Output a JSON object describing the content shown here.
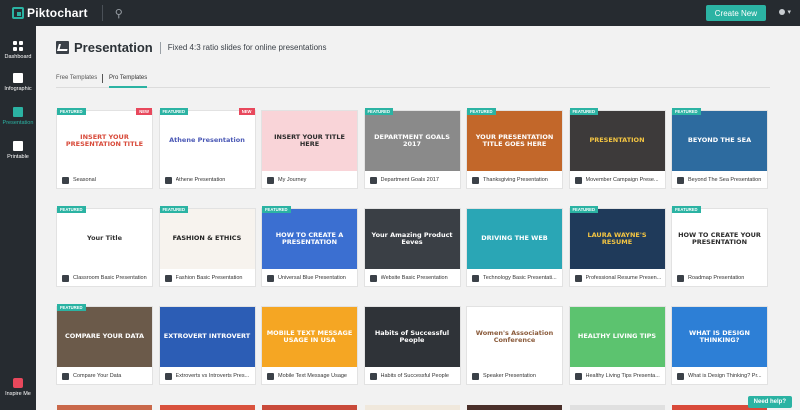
{
  "app": {
    "logo": "Piktochart"
  },
  "topbar": {
    "create_label": "Create New"
  },
  "sidebar": {
    "items": [
      {
        "label": "Dashboard",
        "icon": "dashboard-icon"
      },
      {
        "label": "Infographic",
        "icon": "infographic-icon"
      },
      {
        "label": "Presentation",
        "icon": "presentation-icon"
      },
      {
        "label": "Printable",
        "icon": "printable-icon"
      }
    ],
    "inspire_label": "Inspire Me"
  },
  "header": {
    "title": "Presentation",
    "subtitle": "Fixed 4:3 ratio slides for online presentations"
  },
  "tabs": [
    {
      "label": "Free Templates"
    },
    {
      "label": "Pro Templates"
    }
  ],
  "badges": {
    "featured": "FEATURED",
    "new": "NEW"
  },
  "templates": [
    {
      "name": "Seasonal",
      "thumb": "INSERT YOUR PRESENTATION TITLE",
      "bg": "#ffffff",
      "fg": "#d84a3a",
      "featured": true,
      "new": true
    },
    {
      "name": "Athene Presentation",
      "thumb": "Athene Presentation",
      "bg": "#ffffff",
      "fg": "#4a58b5",
      "featured": true,
      "new": true
    },
    {
      "name": "My Journey",
      "thumb": "INSERT YOUR TITLE HERE",
      "bg": "#f9d4d8",
      "fg": "#2a2a2a",
      "featured": false,
      "new": false
    },
    {
      "name": "Department Goals 2017",
      "thumb": "DEPARTMENT GOALS 2017",
      "bg": "#8a8a8a",
      "fg": "#ffffff",
      "featured": true,
      "new": false
    },
    {
      "name": "Thanksgiving Presentation",
      "thumb": "YOUR PRESENTATION TITLE GOES HERE",
      "bg": "#c2672a",
      "fg": "#ffffff",
      "featured": true,
      "new": false
    },
    {
      "name": "Movember Campaign Prese...",
      "thumb": "PRESENTATION",
      "bg": "#3d3a3a",
      "fg": "#f4c542",
      "featured": true,
      "new": false
    },
    {
      "name": "Beyond The Sea Presentation",
      "thumb": "BEYOND THE SEA",
      "bg": "#2d6b9f",
      "fg": "#ffffff",
      "featured": true,
      "new": false
    },
    {
      "name": "Classroom Basic Presentation",
      "thumb": "Your Title",
      "bg": "#ffffff",
      "fg": "#333333",
      "featured": true,
      "new": false
    },
    {
      "name": "Fashion Basic Presentation",
      "thumb": "FASHION & ETHICS",
      "bg": "#f7f3ee",
      "fg": "#222222",
      "featured": true,
      "new": false
    },
    {
      "name": "Universal Blue Presentation",
      "thumb": "HOW TO CREATE A PRESENTATION",
      "bg": "#3b6fd1",
      "fg": "#ffffff",
      "featured": true,
      "new": false
    },
    {
      "name": "Website Basic Presentation",
      "thumb": "Your Amazing Product Eeves",
      "bg": "#3a3f45",
      "fg": "#ffffff",
      "featured": false,
      "new": false
    },
    {
      "name": "Technology Basic Presentati...",
      "thumb": "DRIVING THE WEB",
      "bg": "#2aa6b5",
      "fg": "#ffffff",
      "featured": false,
      "new": false
    },
    {
      "name": "Professional Resume Presen...",
      "thumb": "LAURA WAYNE'S RESUME",
      "bg": "#1f3a5a",
      "fg": "#f4c542",
      "featured": true,
      "new": false
    },
    {
      "name": "Roadmap Presentation",
      "thumb": "HOW TO CREATE YOUR PRESENTATION",
      "bg": "#ffffff",
      "fg": "#2a2a2a",
      "featured": true,
      "new": false
    },
    {
      "name": "Compare Your Data",
      "thumb": "COMPARE YOUR DATA",
      "bg": "#6b5a4a",
      "fg": "#ffffff",
      "featured": true,
      "new": false
    },
    {
      "name": "Extroverts vs Introverts Pres...",
      "thumb": "EXTROVERT INTROVERT",
      "bg": "#2c5db5",
      "fg": "#ffffff",
      "featured": false,
      "new": false
    },
    {
      "name": "Mobile Text Message Usage",
      "thumb": "MOBILE TEXT MESSAGE USAGE IN USA",
      "bg": "#f5a623",
      "fg": "#ffffff",
      "featured": false,
      "new": false
    },
    {
      "name": "Habits of Successful People",
      "thumb": "Habits of Successful People",
      "bg": "#2f3338",
      "fg": "#ffffff",
      "featured": false,
      "new": false
    },
    {
      "name": "Speaker Presentation",
      "thumb": "Women's Association Conference",
      "bg": "#ffffff",
      "fg": "#8a5a3a",
      "featured": false,
      "new": false
    },
    {
      "name": "Healthy Living Tips Presenta...",
      "thumb": "HEALTHY LIVING TIPS",
      "bg": "#5cc36f",
      "fg": "#ffffff",
      "featured": false,
      "new": false
    },
    {
      "name": "What is Design Thinking? Pr...",
      "thumb": "WHAT IS DESIGN THINKING?",
      "bg": "#2d7fd6",
      "fg": "#ffffff",
      "featured": false,
      "new": false
    }
  ],
  "help_label": "Need help?",
  "colors": {
    "accent": "#2bb3a3",
    "topbar": "#262b30",
    "new_badge": "#e8485c"
  }
}
